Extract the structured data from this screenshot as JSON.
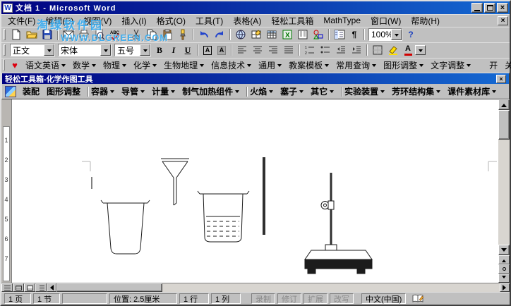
{
  "window": {
    "title": "文档 1 - Microsoft Word"
  },
  "watermark": {
    "line1": "淘绿软件园",
    "line2": "WWW.DLGREEN.COM"
  },
  "icons": {
    "word_logo": "W",
    "close": "×",
    "doc_close": "×",
    "toolbox_close": "×",
    "heart": "♥",
    "spelling": "ABC",
    "show_hide": "¶",
    "help": "?",
    "bold": "B",
    "italic": "I",
    "underline": "U",
    "char_border": "A",
    "char_shading": "A",
    "font_color": "A"
  },
  "menu": {
    "items": [
      "文件(F)",
      "编辑(E)",
      "视图(V)",
      "插入(I)",
      "格式(O)",
      "工具(T)",
      "表格(A)",
      "轻松工具箱",
      "MathType",
      "窗口(W)",
      "帮助(H)"
    ]
  },
  "standard_toolbar": {
    "zoom": "100%"
  },
  "formatting_toolbar": {
    "style": "正文",
    "font": "宋体",
    "size": "五号"
  },
  "subject_toolbar": {
    "items": [
      {
        "label": "语文英语",
        "arrow": true
      },
      {
        "label": "数学",
        "arrow": true
      },
      {
        "label": "物理",
        "arrow": true
      },
      {
        "label": "化学",
        "arrow": true
      },
      {
        "label": "生物地理",
        "arrow": true
      },
      {
        "label": "信息技术",
        "arrow": true
      },
      {
        "label": "通用",
        "arrow": true
      },
      {
        "label": "教案模板",
        "arrow": true
      },
      {
        "label": "常用查询",
        "arrow": true
      },
      {
        "label": "图形调整",
        "arrow": true
      },
      {
        "label": "文字调整",
        "arrow": true
      },
      {
        "label": "开",
        "gap": true
      },
      {
        "label": "关",
        "arrow": true
      }
    ]
  },
  "toolbox": {
    "title": "轻松工具箱-化学作图工具",
    "items": [
      {
        "label": "装配"
      },
      {
        "label": "图形调整"
      },
      {
        "label": "容器",
        "arrow": true,
        "sep": true
      },
      {
        "label": "导管",
        "arrow": true
      },
      {
        "label": "计量",
        "arrow": true
      },
      {
        "label": "制气加热组件",
        "arrow": true
      },
      {
        "label": "火焰",
        "arrow": true,
        "sep": true
      },
      {
        "label": "塞子",
        "arrow": true
      },
      {
        "label": "其它",
        "arrow": true
      },
      {
        "label": "实验装置",
        "arrow": true,
        "sep": true
      },
      {
        "label": "芳环结构集",
        "arrow": true
      },
      {
        "label": "课件素材库",
        "arrow": true
      }
    ]
  },
  "ruler": {
    "numbers": [
      "1",
      "2",
      "3",
      "4",
      "5",
      "6",
      "7"
    ]
  },
  "statusbar": {
    "page": "1 页",
    "section": "1 节",
    "blank": "",
    "position": "位置: 2.5厘米",
    "line": "1 行",
    "column": "1 列",
    "indicators": [
      {
        "label": "录制",
        "dim": true
      },
      {
        "label": "修订",
        "dim": true
      },
      {
        "label": "扩展",
        "dim": true
      },
      {
        "label": "改写",
        "dim": true
      }
    ],
    "language": "中文(中国)"
  }
}
